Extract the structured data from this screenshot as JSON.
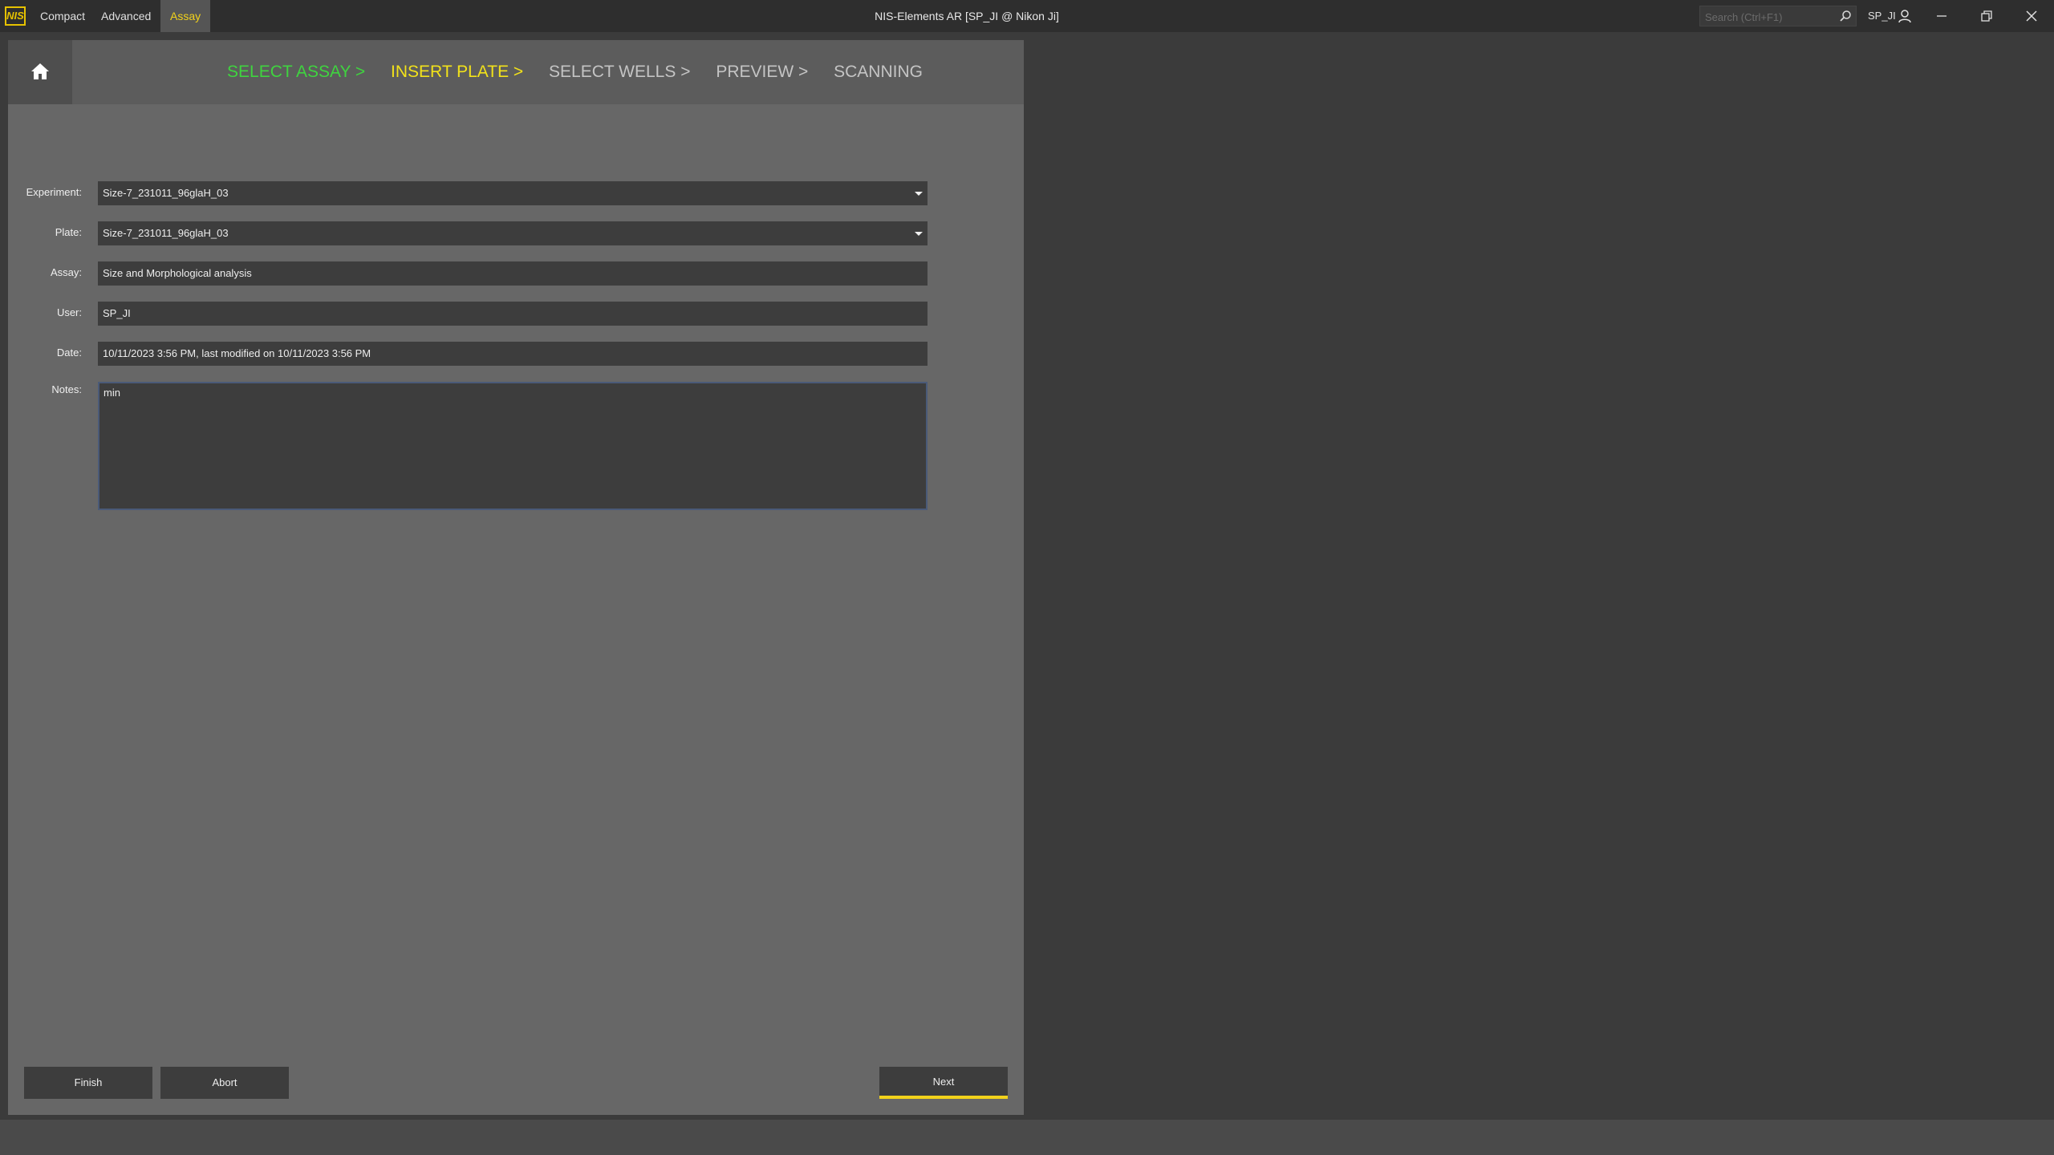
{
  "titlebar": {
    "logo_text": "NIS",
    "modes": [
      "Compact",
      "Advanced",
      "Assay"
    ],
    "active_mode": "Assay",
    "window_title": "NIS-Elements AR [SP_JI @ Nikon Ji]",
    "search_placeholder": "Search (Ctrl+F1)",
    "user": "SP_JI"
  },
  "wizard": {
    "steps": [
      {
        "label": "SELECT ASSAY >",
        "state": "done"
      },
      {
        "label": "INSERT PLATE >",
        "state": "current"
      },
      {
        "label": "SELECT WELLS >",
        "state": "todo"
      },
      {
        "label": "PREVIEW >",
        "state": "todo"
      },
      {
        "label": "SCANNING",
        "state": "todo"
      }
    ]
  },
  "form": {
    "experiment_label": "Experiment:",
    "experiment_value": "Size-7_231011_96glaH_03",
    "plate_label": "Plate:",
    "plate_value": "Size-7_231011_96glaH_03",
    "assay_label": "Assay:",
    "assay_value": "Size and Morphological analysis",
    "user_label": "User:",
    "user_value": "SP_JI",
    "date_label": "Date:",
    "date_value": "10/11/2023 3:56 PM, last modified on 10/11/2023 3:56 PM",
    "notes_label": "Notes:",
    "notes_value": "min"
  },
  "buttons": {
    "finish": "Finish",
    "abort": "Abort",
    "next": "Next"
  },
  "colors": {
    "accent_yellow": "#f2d21b",
    "step_done_green": "#3fd43f",
    "step_current_yellow": "#f2e21a",
    "panel_bg": "#676767"
  }
}
